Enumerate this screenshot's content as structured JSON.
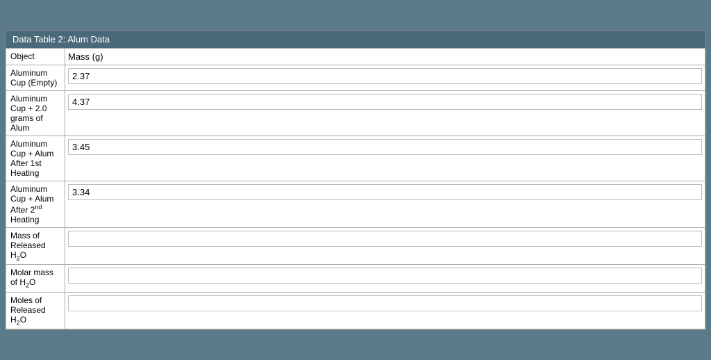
{
  "window": {
    "title": "Data Table 2: Alum Data"
  },
  "table": {
    "header": {
      "col1": "Object",
      "col2": "Mass (g)"
    },
    "rows": [
      {
        "id": "row-aluminum-cup-empty",
        "label": "Aluminum Cup (Empty)",
        "value": "2.37",
        "placeholder": ""
      },
      {
        "id": "row-aluminum-cup-alum",
        "label": "Aluminum Cup + 2.0 grams of Alum",
        "value": "4.37",
        "placeholder": ""
      },
      {
        "id": "row-aluminum-cup-after-1st",
        "label": "Aluminum Cup + Alum After 1st Heating",
        "value": "3.45",
        "placeholder": ""
      },
      {
        "id": "row-aluminum-cup-after-2nd",
        "label": "Aluminum Cup + Alum After 2nd Heating",
        "value": "3.34",
        "placeholder": ""
      },
      {
        "id": "row-mass-of-released",
        "label": "Mass of Released H2O",
        "value": "",
        "placeholder": ""
      },
      {
        "id": "row-molar-mass",
        "label": "Molar mass of H2O",
        "value": "",
        "placeholder": ""
      },
      {
        "id": "row-moles-of-released",
        "label": "Moles of Released H2O",
        "value": "",
        "placeholder": ""
      }
    ]
  }
}
